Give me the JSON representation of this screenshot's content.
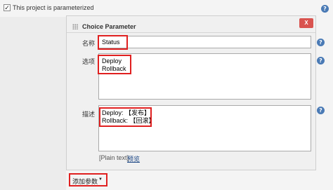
{
  "project": {
    "checkbox_checked": true,
    "label": "This project is parameterized"
  },
  "panel": {
    "title": "Choice Parameter",
    "delete_label": "X",
    "name_label": "名称",
    "name_value": "Status",
    "choices_label": "选项",
    "choices_value": "Deploy\nRollback",
    "description_label": "描述",
    "description_value": "Deploy: 【发布】\nRollback: 【回滚】",
    "plain_text_label": "[Plain text]",
    "preview_link": "预览"
  },
  "add_parameter": {
    "label": "添加参数",
    "caret": "▼"
  },
  "help_icon_glyph": "?",
  "colors": {
    "highlight": "#e02020",
    "help_icon": "#4a7ab5",
    "delete_button": "#d9534f",
    "link": "#204a87"
  }
}
